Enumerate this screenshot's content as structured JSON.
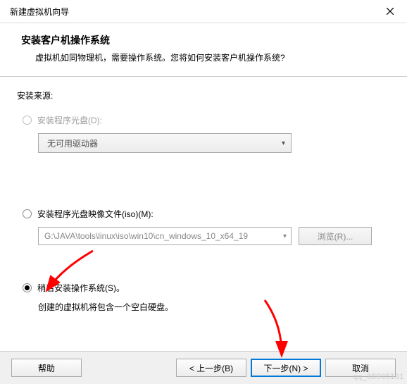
{
  "titlebar": {
    "title": "新建虚拟机向导"
  },
  "header": {
    "title": "安装客户机操作系统",
    "subtitle": "虚拟机如同物理机，需要操作系统。您将如何安装客户机操作系统?"
  },
  "source": {
    "label": "安装来源:",
    "disc": {
      "label": "安装程序光盘(D):",
      "dropdown": "无可用驱动器"
    },
    "iso": {
      "label": "安装程序光盘映像文件(iso)(M):",
      "path": "G:\\JAVA\\tools\\linux\\iso\\win10\\cn_windows_10_x64_19",
      "browse": "浏览(R)..."
    },
    "later": {
      "label": "稍后安装操作系统(S)。",
      "note": "创建的虚拟机将包含一个空白硬盘。"
    }
  },
  "footer": {
    "help": "帮助",
    "back": "< 上一步(B)",
    "next": "下一步(N) >",
    "cancel": "取消"
  },
  "watermark": "qq_38905131"
}
